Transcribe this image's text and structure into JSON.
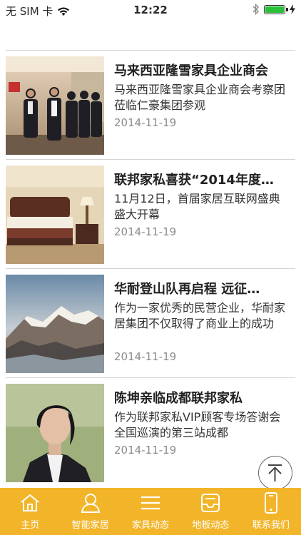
{
  "status_bar": {
    "carrier": "无 SIM 卡",
    "time": "12:22"
  },
  "news": [
    {
      "title": "马来西亚隆雪家具企业商会",
      "summary": "马来西亚隆雪家具企业商会考察团莅临仁豪集团参观",
      "date": "2014-11-19",
      "thumb": "people-visit-photo"
    },
    {
      "title": "联邦家私喜获“2014年度…",
      "summary": "11月12日，首届家居互联网盛典盛大开幕",
      "date": "2014-11-19",
      "thumb": "bedroom-photo"
    },
    {
      "title": "华耐登山队再启程 远征…",
      "summary": "作为一家优秀的民营企业，华耐家居集团不仅取得了商业上的成功",
      "date": "2014-11-19",
      "thumb": "snow-mountain-photo"
    },
    {
      "title": "陈坤亲临成都联邦家私",
      "summary": "作为联邦家私VIP顾客专场答谢会全国巡演的第三站成都",
      "date": "2014-11-19",
      "thumb": "portrait-photo"
    }
  ],
  "tabs": [
    {
      "label": "主页",
      "icon": "home-icon"
    },
    {
      "label": "智能家居",
      "icon": "person-icon"
    },
    {
      "label": "家具动态",
      "icon": "menu-icon"
    },
    {
      "label": "地板动态",
      "icon": "tray-icon"
    },
    {
      "label": "联系我们",
      "icon": "phone-icon"
    }
  ],
  "colors": {
    "tab_bar": "#f2b52a",
    "battery": "#29c13a"
  }
}
